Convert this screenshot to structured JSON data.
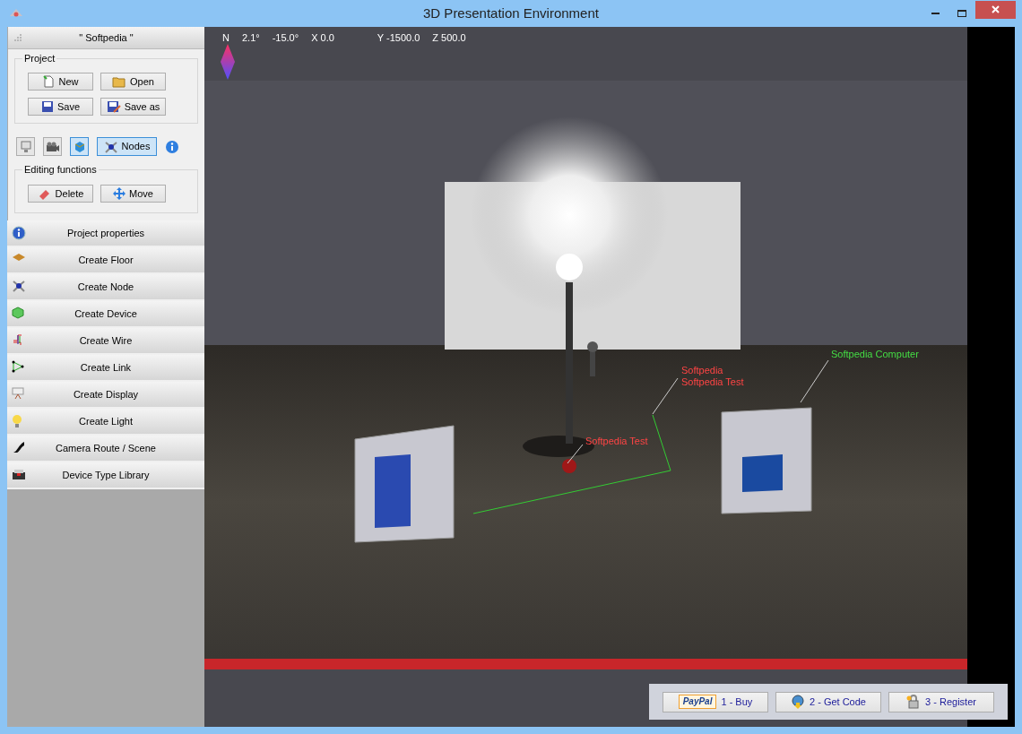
{
  "window": {
    "title": "3D Presentation Environment"
  },
  "panel": {
    "title": "\" Softpedia \"",
    "project": {
      "label": "Project",
      "buttons": [
        {
          "kind": "new",
          "label": "New"
        },
        {
          "kind": "open",
          "label": "Open"
        },
        {
          "kind": "save",
          "label": "Save"
        },
        {
          "kind": "saveas",
          "label": "Save as"
        }
      ]
    },
    "view_toggles": [
      {
        "kind": "display",
        "selected": false
      },
      {
        "kind": "camera",
        "selected": false
      },
      {
        "kind": "cube",
        "selected": true
      },
      {
        "kind": "nodes",
        "label": "Nodes",
        "selected": true
      }
    ],
    "editing": {
      "label": "Editing functions",
      "buttons": [
        {
          "kind": "delete",
          "label": "Delete"
        },
        {
          "kind": "move",
          "label": "Move"
        }
      ]
    },
    "menu": [
      {
        "kind": "info",
        "label": "Project properties"
      },
      {
        "kind": "floor",
        "label": "Create Floor"
      },
      {
        "kind": "node",
        "label": "Create Node"
      },
      {
        "kind": "device",
        "label": "Create Device"
      },
      {
        "kind": "wire",
        "label": "Create Wire"
      },
      {
        "kind": "link",
        "label": "Create Link"
      },
      {
        "kind": "display",
        "label": "Create Display"
      },
      {
        "kind": "light",
        "label": "Create Light"
      },
      {
        "kind": "camera",
        "label": "Camera Route / Scene"
      },
      {
        "kind": "library",
        "label": "Device Type Library"
      }
    ]
  },
  "viewport": {
    "readout": [
      "N",
      "2.1°",
      "-15.0°",
      "X 0.0",
      "Y -1500.0",
      "Z 500.0"
    ],
    "scene_labels": [
      {
        "lines": [
          "Softpedia",
          "Softpedia Test"
        ],
        "color": "#ff4444"
      },
      {
        "lines": [
          "Softpedia Test"
        ],
        "color": "#ff4444"
      },
      {
        "lines": [
          "Softpedia Computer"
        ],
        "color": "#44dd44"
      }
    ]
  },
  "purchase_buttons": [
    {
      "kind": "paypal",
      "badge": "PayPal",
      "label": "1 - Buy"
    },
    {
      "kind": "code",
      "label": "2 - Get Code"
    },
    {
      "kind": "register",
      "label": "3 - Register"
    }
  ]
}
